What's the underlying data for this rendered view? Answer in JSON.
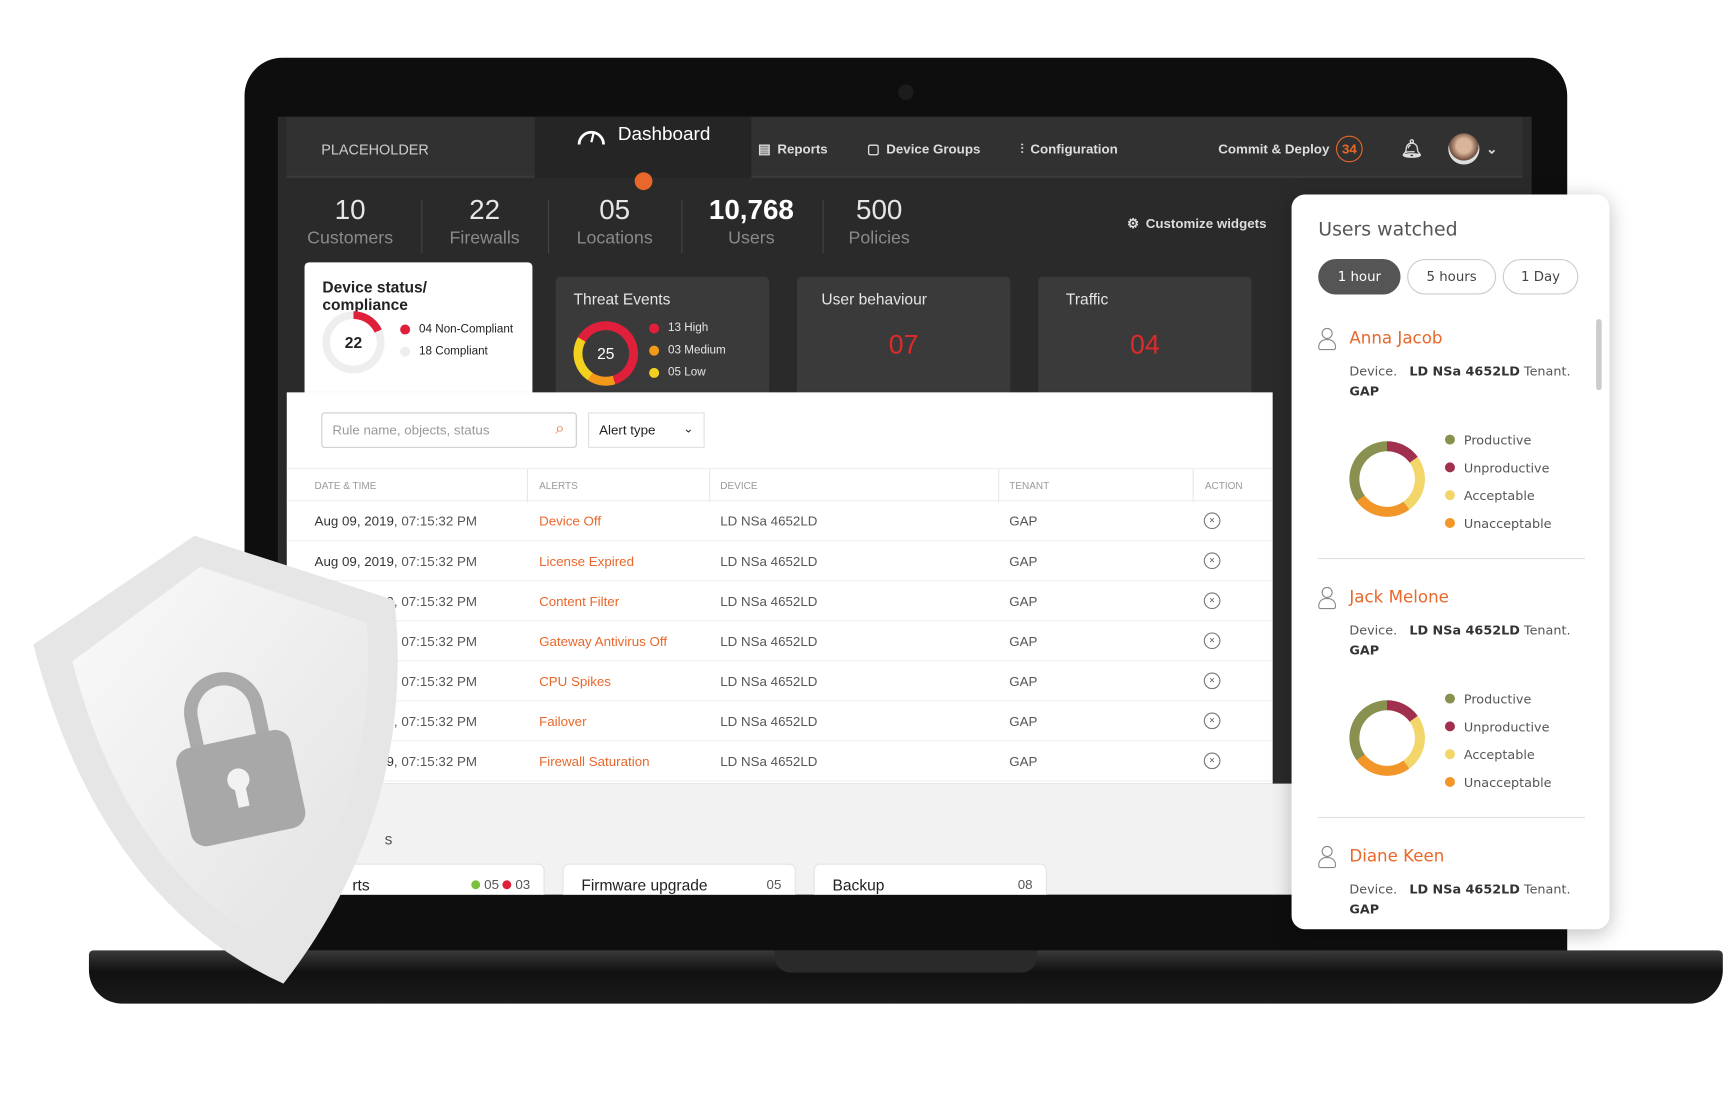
{
  "nav": {
    "placeholder": "PLACEHOLDER",
    "dashboard": "Dashboard",
    "reports": "Reports",
    "device_groups": "Device Groups",
    "configuration": "Configuration",
    "commit_deploy": "Commit & Deploy",
    "commit_count": "34"
  },
  "stats": [
    {
      "value": "10",
      "label": "Customers"
    },
    {
      "value": "22",
      "label": "Firewalls"
    },
    {
      "value": "05",
      "label": "Locations"
    },
    {
      "value": "10,768",
      "label": "Users"
    },
    {
      "value": "500",
      "label": "Policies"
    }
  ],
  "customize": "Customize widgets",
  "device_status": {
    "title": "Device status/ compliance",
    "total": "22",
    "non_compliant": "04 Non-Compliant",
    "compliant": "18 Compliant",
    "non_compliant_value": 4,
    "compliant_value": 18,
    "colors": {
      "non_compliant": "#e0203a",
      "compliant": "#eeeeee"
    }
  },
  "threat": {
    "title": "Threat Events",
    "total": "25",
    "items": [
      {
        "label": "13 High",
        "value": 13,
        "color": "#e0203a"
      },
      {
        "label": "03 Medium",
        "value": 3,
        "color": "#f39a1a"
      },
      {
        "label": "05 Low",
        "value": 5,
        "color": "#f2d21f"
      }
    ]
  },
  "user_behaviour": {
    "title": "User behaviour",
    "value": "07"
  },
  "traffic": {
    "title": "Traffic",
    "value": "04"
  },
  "filters": {
    "search_placeholder": "Rule name, objects, status",
    "alert_type": "Alert type"
  },
  "table": {
    "headers": [
      "DATE & TIME",
      "ALERTS",
      "DEVICE",
      "TENANT",
      "ACTION"
    ],
    "rows": [
      {
        "date": "Aug 09, 2019",
        "time": ", 07:15:32 PM",
        "alert": "Device Off",
        "device": "LD NSa 4652LD",
        "tenant": "GAP"
      },
      {
        "date": "Aug 09, 2019",
        "time": ", 07:15:32 PM",
        "alert": "License Expired",
        "device": "LD NSa 4652LD",
        "tenant": "GAP"
      },
      {
        "date": "Aug 09, 2019",
        "time": ", 07:15:32 PM",
        "alert": "Content Filter",
        "device": "LD NSa 4652LD",
        "tenant": "GAP"
      },
      {
        "date": "Aug 09, 2019",
        "time": ", 07:15:32 PM",
        "alert": "Gateway Antivirus Off",
        "device": "LD NSa 4652LD",
        "tenant": "GAP"
      },
      {
        "date": "Aug 09, 2019",
        "time": ", 07:15:32 PM",
        "alert": "CPU Spikes",
        "device": "LD NSa 4652LD",
        "tenant": "GAP"
      },
      {
        "date": "Aug 09, 2019",
        "time": ", 07:15:32 PM",
        "alert": "Failover",
        "device": "LD NSa 4652LD",
        "tenant": "GAP"
      },
      {
        "date": "Aug 09, 2019",
        "time": ", 07:15:32 PM",
        "alert": "Firewall Saturation",
        "device": "LD NSa 4652LD",
        "tenant": "GAP"
      }
    ]
  },
  "bottom": {
    "section_title": "s",
    "cards": [
      {
        "label": "rts",
        "green": "05",
        "red": "03"
      },
      {
        "label": "Firmware upgrade",
        "value": "05"
      },
      {
        "label": "Backup",
        "value": "08"
      }
    ]
  },
  "users_panel": {
    "title": "Users watched",
    "ranges": [
      "1 hour",
      "5 hours",
      "1 Day"
    ],
    "active_range": "1 hour",
    "legend": [
      {
        "label": "Productive",
        "color": "#8a9150",
        "share": 0.35
      },
      {
        "label": "Unproductive",
        "color": "#a0304e",
        "share": 0.15
      },
      {
        "label": "Acceptable",
        "color": "#f2d66a",
        "share": 0.25
      },
      {
        "label": "Unacceptable",
        "color": "#f3962a",
        "share": 0.25
      }
    ],
    "users": [
      {
        "name": "Anna Jacob",
        "device_label": "Device.",
        "device": "LD NSa 4652LD",
        "tenant_label": "Tenant.",
        "tenant": "GAP"
      },
      {
        "name": "Jack Melone",
        "device_label": "Device.",
        "device": "LD NSa 4652LD",
        "tenant_label": "Tenant.",
        "tenant": "GAP"
      },
      {
        "name": "Diane Keen",
        "device_label": "Device.",
        "device": "LD NSa 4652LD",
        "tenant_label": "Tenant.",
        "tenant": "GAP"
      }
    ]
  },
  "colors": {
    "accent": "#e8672a",
    "alert_red": "#e02a2a"
  }
}
